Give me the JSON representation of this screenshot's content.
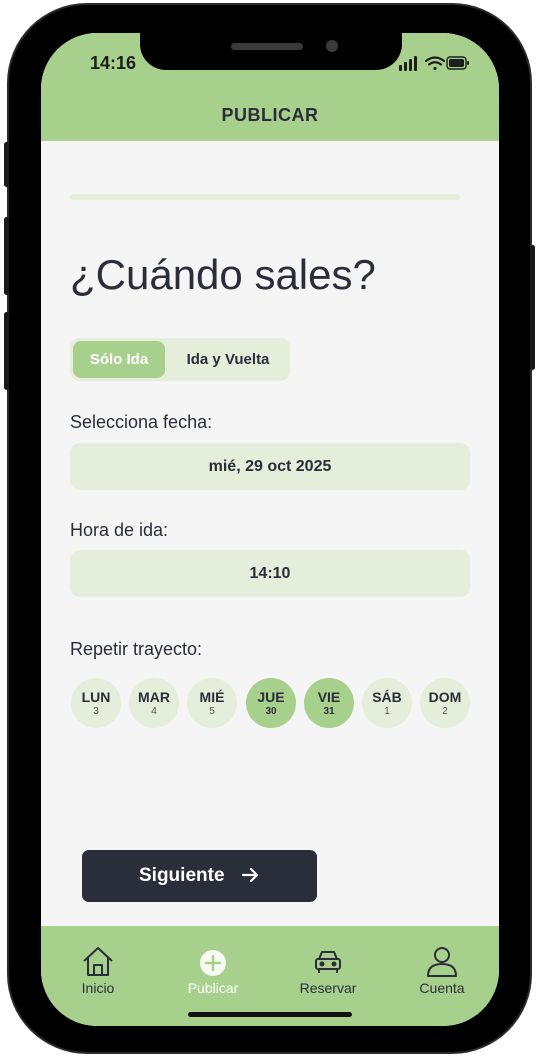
{
  "status_bar": {
    "time": "14:16"
  },
  "header": {
    "title": "PUBLICAR"
  },
  "question": "¿Cuándo sales?",
  "trip_type": {
    "options": [
      "Sólo Ida",
      "Ida y Vuelta"
    ],
    "selected": "Sólo Ida"
  },
  "date": {
    "label": "Selecciona fecha:",
    "value": "mié, 29 oct 2025"
  },
  "time": {
    "label": "Hora de ida:",
    "value": "14:10"
  },
  "repeat": {
    "label": "Repetir trayecto:",
    "days": [
      {
        "name": "LUN",
        "num": "3",
        "selected": false
      },
      {
        "name": "MAR",
        "num": "4",
        "selected": false
      },
      {
        "name": "MIÉ",
        "num": "5",
        "selected": false
      },
      {
        "name": "JUE",
        "num": "30",
        "selected": true
      },
      {
        "name": "VIE",
        "num": "31",
        "selected": true
      },
      {
        "name": "SÁB",
        "num": "1",
        "selected": false
      },
      {
        "name": "DOM",
        "num": "2",
        "selected": false
      }
    ]
  },
  "next_button": {
    "label": "Siguiente"
  },
  "tabbar": {
    "items": [
      {
        "label": "Inicio",
        "icon": "home-icon",
        "active": false
      },
      {
        "label": "Publicar",
        "icon": "plus-circle-icon",
        "active": true
      },
      {
        "label": "Reservar",
        "icon": "car-icon",
        "active": false
      },
      {
        "label": "Cuenta",
        "icon": "user-icon",
        "active": false
      }
    ]
  },
  "colors": {
    "accent": "#a8d08d",
    "accent_light": "#e4eedb",
    "dark": "#2a2d3a",
    "background": "#f5f5f5"
  }
}
